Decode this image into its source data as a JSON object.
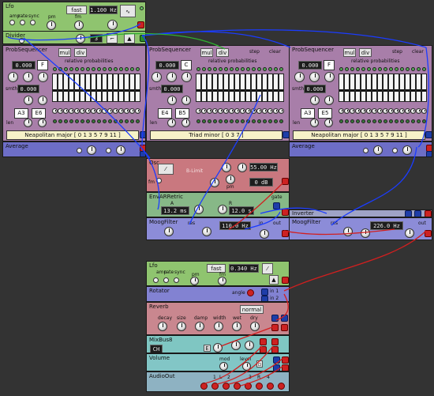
{
  "lfo_top": {
    "title": "Lfo",
    "mode": "fast",
    "freq": "1.100 Hz",
    "labels": {
      "amp": "amp",
      "rate": "rate",
      "sync": "sync",
      "pm": "pm",
      "fm": "fm"
    }
  },
  "divider": {
    "title": "Divider",
    "value": "3"
  },
  "seq1": {
    "title": "ProbSequencer",
    "b1": "mul",
    "b2": "div",
    "note1": "0.000",
    "note2": "F",
    "smth": "smth",
    "smth_val": "0.000",
    "rel_prob": "relative probabilities",
    "len": "len",
    "low": "A3",
    "high": "E6",
    "scale": "Neapolitan major [ 0 1 3 5 7 9 11 ]"
  },
  "seq2": {
    "title": "ProbSequencer",
    "b1": "mul",
    "b2": "div",
    "step": "step",
    "clear": "clear",
    "note1": "0.000",
    "note2": "C",
    "smth": "smth",
    "smth_val": "0.000",
    "rel_prob": "relative probabilities",
    "len": "len",
    "low": "E4",
    "high": "B5",
    "scale": "Triad minor [ 0 3 7 ]"
  },
  "seq3": {
    "title": "ProbSequencer",
    "b1": "mul",
    "b2": "div",
    "step": "step",
    "clear": "clear",
    "note1": "0.000",
    "note2": "F",
    "smth": "smth",
    "smth_val": "0.000",
    "rel_prob": "relative probabilities",
    "len": "len",
    "low": "A3",
    "high": "E5",
    "scale": "Neapolitan major [ 0 1 3 5 7 9 11 ]"
  },
  "average_left": {
    "title": "Average"
  },
  "average_right": {
    "title": "Average"
  },
  "osc": {
    "title": "Osc",
    "mode": "B-Limit",
    "freq": "55.00 Hz",
    "db": "0 dB",
    "fm": "fm",
    "pm": "pm"
  },
  "env": {
    "title": "EnvARRetric",
    "a_label": "A",
    "a_val": "13.2 ms",
    "r_label": "R",
    "r_val": "12.0 s",
    "gate": "gate"
  },
  "moog_left": {
    "title": "MoogFilter",
    "cutoff": "110.0 Hz",
    "res": "res",
    "cutoff_lbl": "cutoff",
    "in": "in",
    "out": "out"
  },
  "inverter": {
    "title": "Inverter"
  },
  "moog_right": {
    "title": "MoogFilter",
    "cutoff": "226.0 Hz",
    "res": "res",
    "out": "out"
  },
  "lfo_bottom": {
    "title": "Lfo",
    "mode": "fast",
    "freq": "0.340 Hz",
    "labels": {
      "amp": "amp",
      "rate": "rate",
      "sync": "sync",
      "pm": "pm",
      "fm": "fm"
    }
  },
  "rotator": {
    "title": "Rotator",
    "angle": "angle",
    "in1": "in 1",
    "in2": "in 2"
  },
  "reverb": {
    "title": "Reverb",
    "mode": "normal",
    "knobs": [
      "decay",
      "size",
      "damp",
      "width",
      "wet",
      "dry"
    ]
  },
  "mixbus": {
    "title": "MixBus8",
    "value": "CH"
  },
  "volume": {
    "title": "Volume",
    "mod": "mod",
    "level": "level"
  },
  "audio_out": {
    "title": "AudioOut",
    "chans": [
      "1",
      "2",
      "3",
      "4"
    ],
    "l": "L",
    "r": "R"
  },
  "colors": {
    "bg": "#333333",
    "lfo": "#8fc46f",
    "seq": "#a87ea9",
    "average": "#6d6ec7",
    "osc": "#c9787f",
    "env": "#87b887",
    "moog": "#8c8cd8",
    "rotator": "#8282d2",
    "reverb": "#c9878f",
    "mixbus": "#7fc6c2",
    "volume": "#82c6c6",
    "audio": "#8eb2c2"
  }
}
